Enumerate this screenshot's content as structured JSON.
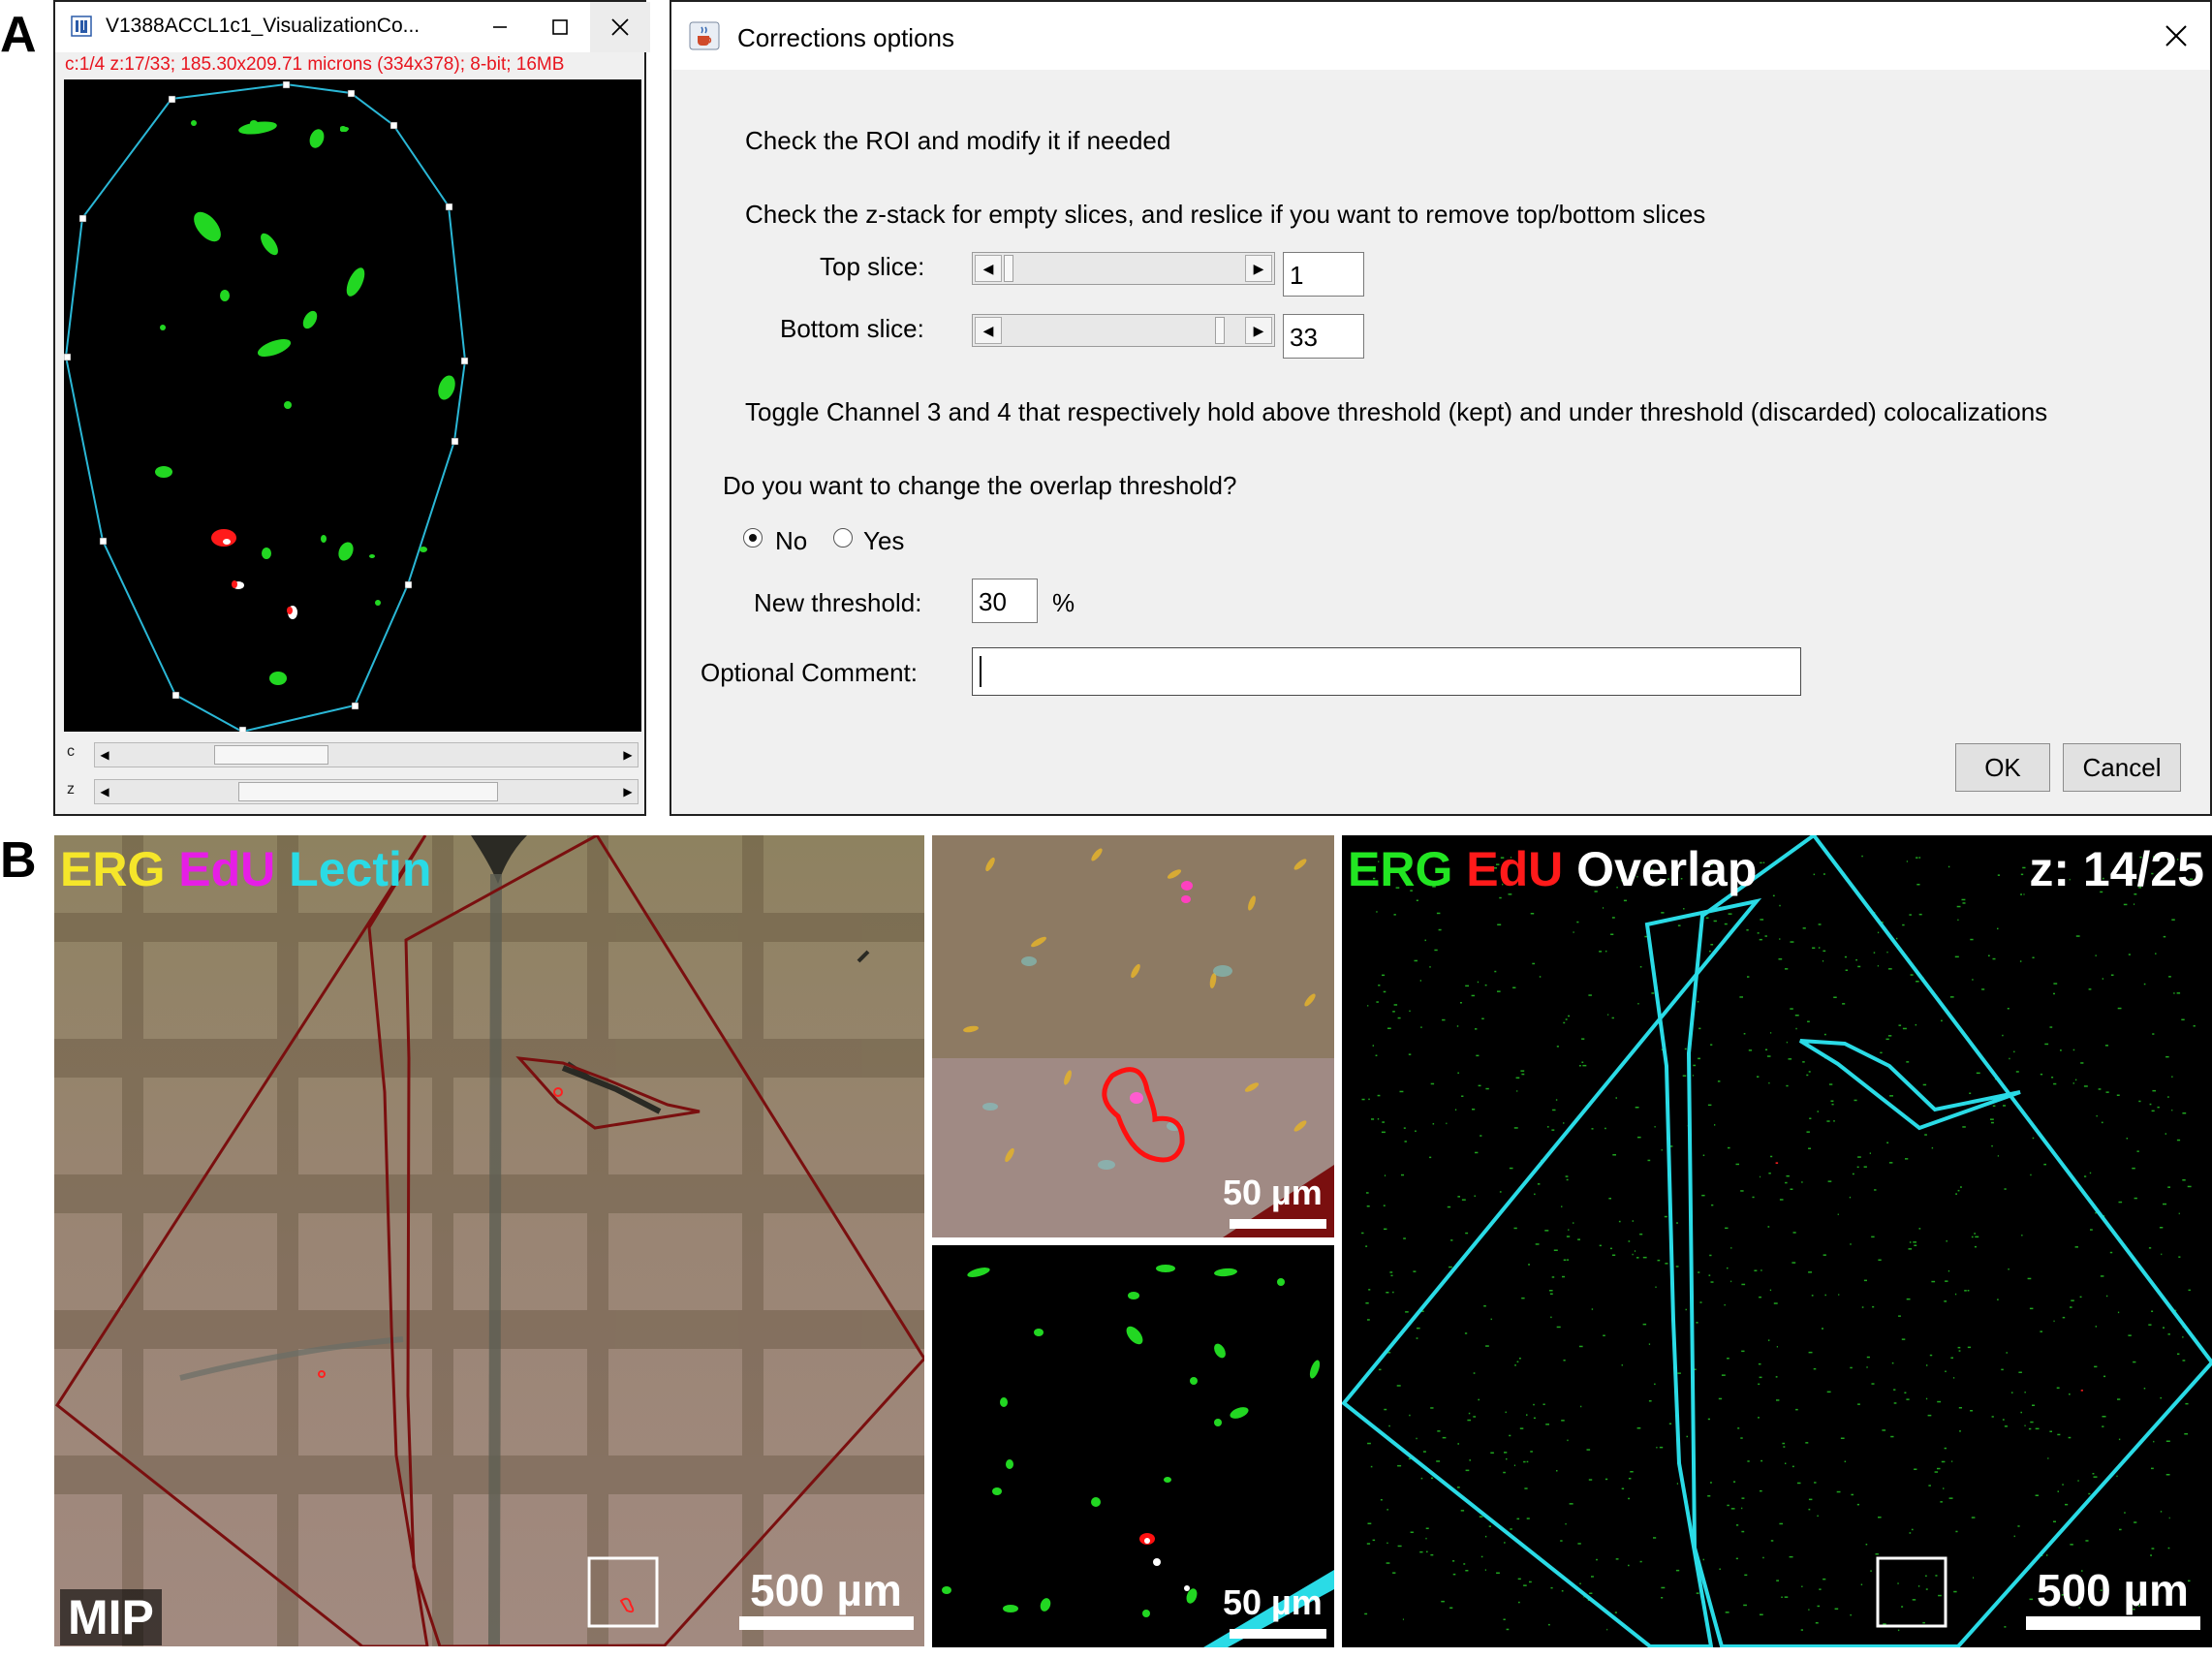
{
  "panel_labels": {
    "a": "A",
    "b": "B"
  },
  "image_window": {
    "title": "V1388ACCL1c1_VisualizationCo...",
    "info": "c:1/4 z:17/33; 185.30x209.71 microns (334x378); 8-bit; 16MB",
    "channel_slider_label": "c",
    "z_slider_label": "z",
    "channel_position": 0.25,
    "z_position": 0.5
  },
  "dialog": {
    "title": "Corrections options",
    "instruction_roi": "Check the ROI and modify it if needed",
    "instruction_zstack": "Check the z-stack for empty slices, and reslice if you want to remove top/bottom slices",
    "top_slice": {
      "label": "Top slice:",
      "value": "1"
    },
    "bottom_slice": {
      "label": "Bottom slice:",
      "value": "33"
    },
    "toggle_text": "Toggle Channel 3 and 4 that respectively hold above threshold (kept) and under threshold (discarded) colocalizations",
    "question": "Do you want to change the overlap threshold?",
    "radio_options": [
      {
        "label": "No",
        "selected": true
      },
      {
        "label": "Yes",
        "selected": false
      }
    ],
    "new_threshold": {
      "label": "New threshold:",
      "value": "30",
      "unit": "%"
    },
    "comment": {
      "label": "Optional Comment:",
      "value": ""
    },
    "ok_label": "OK",
    "cancel_label": "Cancel"
  },
  "panel_b": {
    "mip": {
      "legend": [
        {
          "text": "ERG",
          "color": "#f5e62a"
        },
        {
          "text": "EdU",
          "color": "#e61ee6"
        },
        {
          "text": "Lectin",
          "color": "#2adbe6"
        }
      ],
      "corner_label": "MIP",
      "scale_text": "500 µm"
    },
    "zoom_top": {
      "scale_text": "50 µm"
    },
    "zoom_bottom": {
      "scale_text": "50 µm"
    },
    "overlap": {
      "legend": [
        {
          "text": "ERG",
          "color": "#22e622"
        },
        {
          "text": "EdU",
          "color": "#ff1a1a"
        },
        {
          "text": "Overlap",
          "color": "#ffffff"
        }
      ],
      "z_label": "z: 14/25",
      "scale_text": "500 µm"
    }
  }
}
